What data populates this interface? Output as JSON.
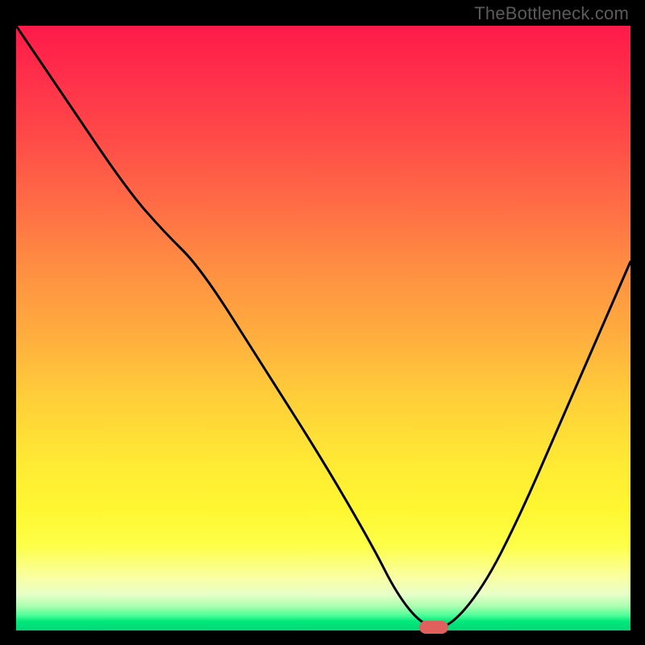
{
  "attribution": "TheBottleneck.com",
  "chart_data": {
    "type": "line",
    "title": "",
    "xlabel": "",
    "ylabel": "",
    "x_range": [
      0,
      100
    ],
    "y_range": [
      0,
      100
    ],
    "series": [
      {
        "name": "curve",
        "x": [
          0,
          8,
          18,
          24,
          30,
          40,
          50,
          58,
          62,
          66,
          70,
          76,
          82,
          88,
          94,
          100
        ],
        "values": [
          100,
          88,
          73,
          66,
          60,
          44,
          28,
          14,
          6,
          1,
          0,
          7,
          19,
          33,
          47,
          61
        ]
      }
    ],
    "marker": {
      "x": 68,
      "y": 0.5
    },
    "gradient_stops": [
      {
        "pos": 0,
        "color": "#ff1a4a"
      },
      {
        "pos": 50,
        "color": "#ffb03e"
      },
      {
        "pos": 80,
        "color": "#fff731"
      },
      {
        "pos": 100,
        "color": "#00d878"
      }
    ]
  }
}
